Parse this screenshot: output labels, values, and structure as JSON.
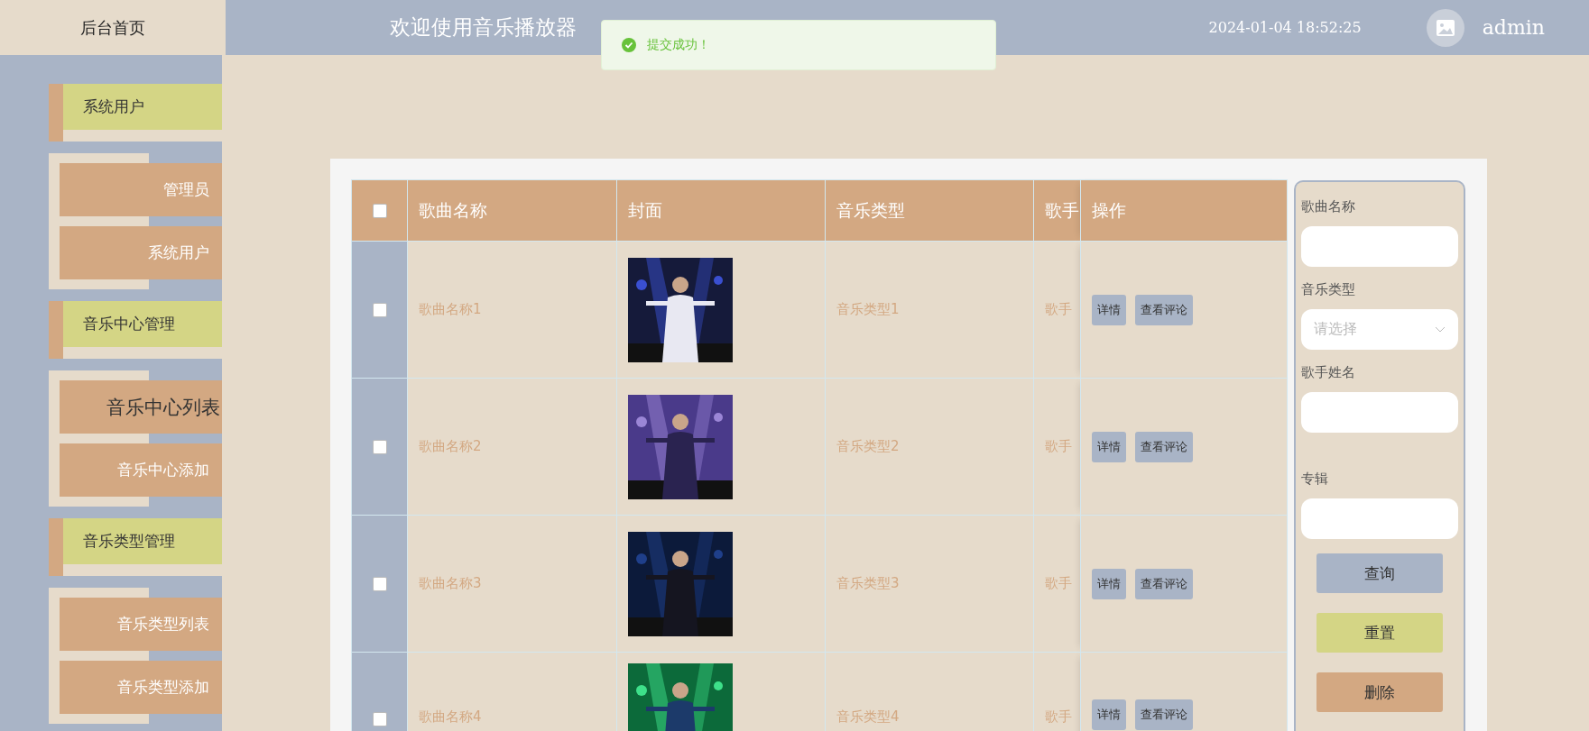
{
  "header": {
    "home": "后台首页",
    "title": "欢迎使用音乐播放器",
    "datetime": "2024-01-04 18:52:25",
    "user": "admin"
  },
  "toast": {
    "message": "提交成功！"
  },
  "sidebar": {
    "groups": [
      {
        "title": "系统用户",
        "items": [
          {
            "label": "管理员",
            "selected": false
          },
          {
            "label": "系统用户",
            "selected": false
          }
        ]
      },
      {
        "title": "音乐中心管理",
        "items": [
          {
            "label": "音乐中心列表",
            "selected": true
          },
          {
            "label": "音乐中心添加",
            "selected": false
          }
        ]
      },
      {
        "title": "音乐类型管理",
        "items": [
          {
            "label": "音乐类型列表",
            "selected": false
          },
          {
            "label": "音乐类型添加",
            "selected": false
          }
        ]
      }
    ]
  },
  "table": {
    "select_all_checked": false,
    "columns": [
      "歌曲名称",
      "封面",
      "音乐类型",
      "歌手",
      "操作"
    ],
    "rows": [
      {
        "checked": false,
        "name": "歌曲名称1",
        "cover": {
          "kind": "picture"
        },
        "type": "音乐类型1",
        "singer": "歌手",
        "actions": [
          "详情",
          "查看评论"
        ]
      },
      {
        "checked": false,
        "name": "歌曲名称2",
        "cover": {
          "kind": "picture"
        },
        "type": "音乐类型2",
        "singer": "歌手",
        "actions": [
          "详情",
          "查看评论"
        ]
      },
      {
        "checked": false,
        "name": "歌曲名称3",
        "cover": {
          "kind": "picture"
        },
        "type": "音乐类型3",
        "singer": "歌手",
        "actions": [
          "详情",
          "查看评论"
        ]
      },
      {
        "checked": false,
        "name": "歌曲名称4",
        "cover": {
          "kind": "picture"
        },
        "type": "音乐类型4",
        "singer": "歌手",
        "actions": [
          "详情",
          "查看评论"
        ]
      }
    ]
  },
  "search": {
    "fields": [
      {
        "kind": "text",
        "label": "歌曲名称"
      },
      {
        "kind": "select",
        "label": "音乐类型",
        "placeholder": "请选择"
      },
      {
        "kind": "text",
        "label": "歌手姓名"
      },
      {
        "kind": "text",
        "label": "专辑"
      }
    ],
    "buttons": [
      {
        "kind": "query",
        "label": "查询"
      },
      {
        "kind": "reset",
        "label": "重置"
      },
      {
        "kind": "delete",
        "label": "删除"
      }
    ]
  }
}
